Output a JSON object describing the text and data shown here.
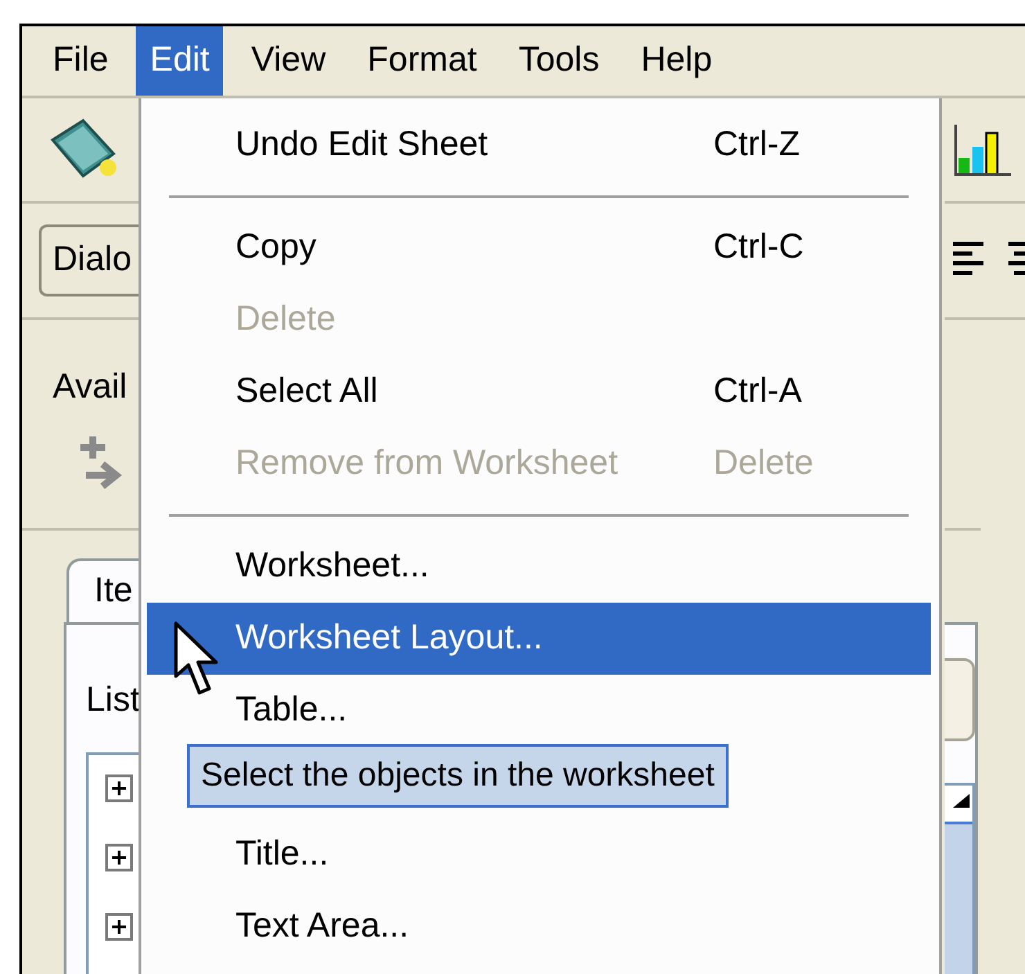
{
  "menu_bar": [
    {
      "label": "File",
      "selected": false
    },
    {
      "label": "Edit",
      "selected": true
    },
    {
      "label": "View",
      "selected": false
    },
    {
      "label": "Format",
      "selected": false
    },
    {
      "label": "Tools",
      "selected": false
    },
    {
      "label": "Help",
      "selected": false
    }
  ],
  "toolbar": {
    "button": "Dialo"
  },
  "left_panel": {
    "label": "Avail",
    "tab": "Ite",
    "list_label": "List"
  },
  "edit_menu": [
    {
      "kind": "item",
      "label": "Undo Edit Sheet",
      "shortcut": "Ctrl-Z",
      "disabled": false,
      "selected": false
    },
    {
      "kind": "separator"
    },
    {
      "kind": "item",
      "label": "Copy",
      "shortcut": "Ctrl-C",
      "disabled": false,
      "selected": false
    },
    {
      "kind": "item",
      "label": "Delete",
      "disabled": true,
      "selected": false
    },
    {
      "kind": "item",
      "label": "Select All",
      "shortcut": "Ctrl-A",
      "disabled": false,
      "selected": false
    },
    {
      "kind": "item",
      "label": "Remove from Worksheet",
      "shortcut": "Delete",
      "disabled": true,
      "selected": false
    },
    {
      "kind": "separator"
    },
    {
      "kind": "item",
      "label": "Worksheet...",
      "disabled": false,
      "selected": false
    },
    {
      "kind": "item",
      "label": "Worksheet Layout...",
      "disabled": false,
      "selected": true
    },
    {
      "kind": "item",
      "label": "Table...",
      "disabled": false,
      "selected": false
    },
    {
      "kind": "covered"
    },
    {
      "kind": "item",
      "label": "Title...",
      "disabled": false,
      "selected": false
    },
    {
      "kind": "item",
      "label": "Text Area...",
      "disabled": false,
      "selected": false
    }
  ],
  "tooltip": "Select the objects in the worksheet"
}
